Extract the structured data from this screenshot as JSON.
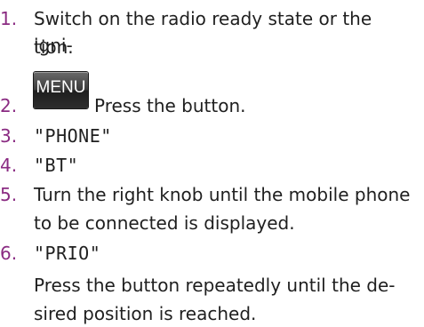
{
  "steps": [
    {
      "number": "1.",
      "lines": [
        "Switch on the radio ready state or the igni-",
        "tion."
      ]
    },
    {
      "number": "2.",
      "button_label": "MENU",
      "text": "Press the button."
    },
    {
      "number": "3.",
      "text": "\"PHONE\""
    },
    {
      "number": "4.",
      "text": "\"BT\""
    },
    {
      "number": "5.",
      "lines": [
        "Turn the right knob until the mobile phone",
        "to be connected is displayed."
      ]
    },
    {
      "number": "6.",
      "text": "\"PRIO\""
    }
  ],
  "note": {
    "lines": [
      "Press the button repeatedly until the de-",
      "sired position is reached."
    ]
  },
  "colors": {
    "step_number": "#8a2b82",
    "text": "#1f1f1f"
  }
}
